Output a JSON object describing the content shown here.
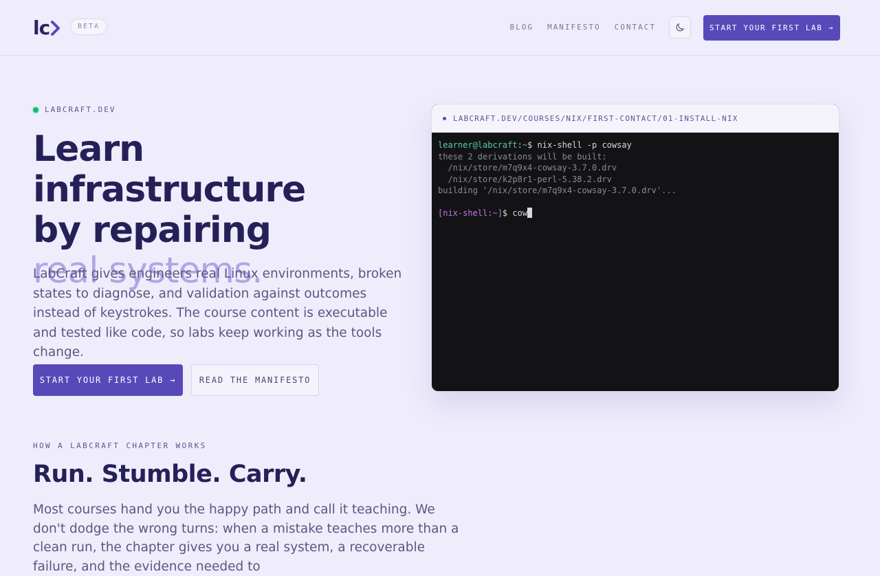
{
  "header": {
    "logo_text": "lc",
    "badge": "BETA",
    "nav": [
      "BLOG",
      "MANIFESTO",
      "CONTACT"
    ],
    "theme_icon": "moon-icon",
    "cta_label": "START YOUR FIRST LAB →"
  },
  "hero": {
    "eyebrow": "LABCRAFT.DEV",
    "title_line1": "Learn infrastructure",
    "title_line2": "by repairing",
    "title_line3": "real systems.",
    "description": "LabCraft gives engineers real Linux environments, broken states to diagnose, and validation against outcomes instead of keystrokes. The course content is executable and tested like code, so labs keep working as the tools change.",
    "primary_button": "START YOUR FIRST LAB →",
    "secondary_button": "READ THE MANIFESTO"
  },
  "terminal": {
    "url": "LABCRAFT.DEV/COURSES/NIX/FIRST-CONTACT/01-INSTALL-NIX",
    "prompt_user": "learner@labcraft",
    "prompt_sep": ":",
    "prompt_path": "~",
    "prompt_symbol": "$",
    "command": "nix-shell -p cowsay",
    "output": [
      "these 2 derivations will be built:",
      "  /nix/store/m7q9x4-cowsay-3.7.0.drv",
      "  /nix/store/k2p8r1-perl-5.38.2.drv",
      "building '/nix/store/m7q9x4-cowsay-3.7.0.drv'..."
    ],
    "shell_prompt": "[nix-shell:~]",
    "shell_symbol": "$",
    "typed": "cow"
  },
  "section": {
    "eyebrow": "HOW A LABCRAFT CHAPTER WORKS",
    "title": "Run. Stumble. Carry.",
    "description": "Most courses hand you the happy path and call it teaching. We don't dodge the wrong turns: when a mistake teaches more than a clean run, the chapter gives you a real system, a recoverable failure, and the evidence needed to"
  },
  "colors": {
    "accent": "#5849b8",
    "background": "#efedfb",
    "heading": "#262058",
    "highlight": "#ada7e6",
    "terminal_bg": "#131316",
    "status_green": "#1fb37d"
  }
}
